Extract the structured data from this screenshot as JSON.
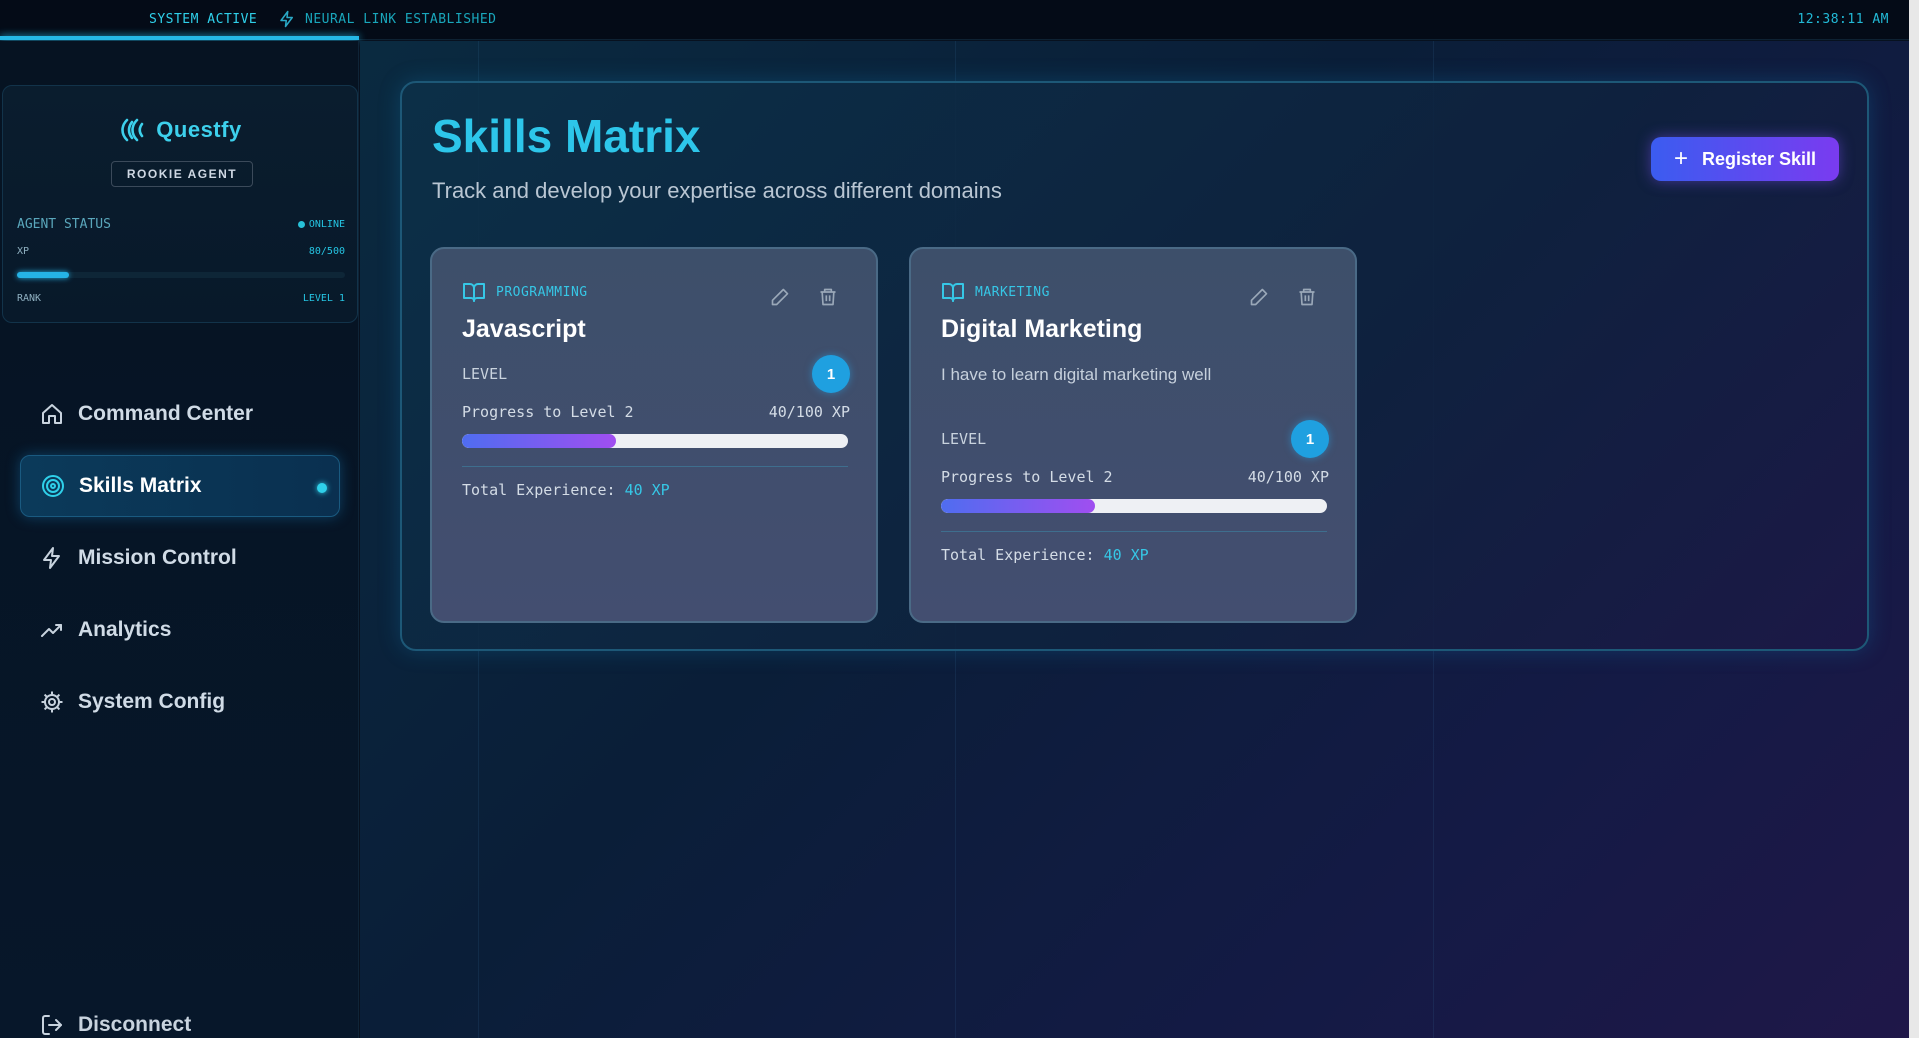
{
  "topbar": {
    "system_status": "SYSTEM ACTIVE",
    "link_status": "NEURAL LINK ESTABLISHED",
    "clock": "12:38:11 AM"
  },
  "sidebar": {
    "brand": "Questfy",
    "rank_badge": "ROOKIE AGENT",
    "agent_status_label": "AGENT STATUS",
    "online_label": "ONLINE",
    "xp_label": "XP",
    "xp_value": "80/500",
    "xp_progress": 0.16,
    "rank_label": "RANK",
    "rank_value": "LEVEL 1",
    "items": [
      {
        "label": "Command Center",
        "icon": "home-icon"
      },
      {
        "label": "Skills Matrix",
        "icon": "target-icon",
        "active": true
      },
      {
        "label": "Mission Control",
        "icon": "bolt-icon"
      },
      {
        "label": "Analytics",
        "icon": "trend-icon"
      },
      {
        "label": "System Config",
        "icon": "gear-icon"
      }
    ],
    "disconnect_label": "Disconnect"
  },
  "main": {
    "title": "Skills Matrix",
    "subtitle": "Track and develop your expertise across different domains",
    "register_label": "Register Skill"
  },
  "skills": [
    {
      "category": "PROGRAMMING",
      "name": "Javascript",
      "description": "",
      "level_label": "LEVEL",
      "level": "1",
      "progress_label": "Progress to Level 2",
      "progress_value": "40/100 XP",
      "progress_fraction": 0.4,
      "total_label": "Total Experience:",
      "total_value": "40 XP"
    },
    {
      "category": "MARKETING",
      "name": "Digital Marketing",
      "description": "I have to learn digital marketing well",
      "level_label": "LEVEL",
      "level": "1",
      "progress_label": "Progress to Level 2",
      "progress_value": "40/100 XP",
      "progress_fraction": 0.4,
      "total_label": "Total Experience:",
      "total_value": "40 XP"
    }
  ],
  "colors": {
    "accent": "#2dc6ea",
    "button_start": "#3b5cf0",
    "button_end": "#7a3bf0",
    "level_badge": "#1fa0e0"
  }
}
